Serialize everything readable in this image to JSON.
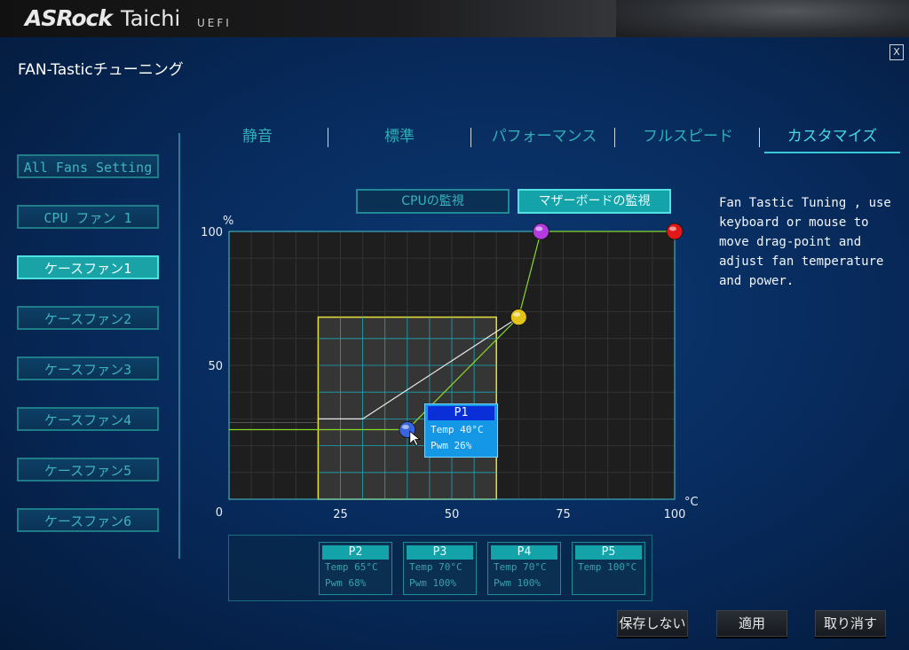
{
  "header": {
    "brand_a": "ASRock",
    "brand_b": "Taichi",
    "brand_c": "UEFI"
  },
  "window": {
    "title": "FAN-Tasticチューニング",
    "close_label": "X"
  },
  "sidebar": {
    "items": [
      {
        "label": "All Fans Setting",
        "active": false
      },
      {
        "label": "CPU ファン 1",
        "active": false
      },
      {
        "label": "ケースファン1",
        "active": true
      },
      {
        "label": "ケースファン2",
        "active": false
      },
      {
        "label": "ケースファン3",
        "active": false
      },
      {
        "label": "ケースファン4",
        "active": false
      },
      {
        "label": "ケースファン5",
        "active": false
      },
      {
        "label": "ケースファン6",
        "active": false
      }
    ]
  },
  "tabs": [
    {
      "label": "静音",
      "active": false
    },
    {
      "label": "標準",
      "active": false
    },
    {
      "label": "パフォーマンス",
      "active": false
    },
    {
      "label": "フルスピード",
      "active": false
    },
    {
      "label": "カスタマイズ",
      "active": true
    }
  ],
  "monitor": {
    "cpu_label": "CPUの監視",
    "mb_label": "マザーボードの監視",
    "selected": "mb"
  },
  "help_text": "Fan Tastic Tuning , use keyboard or mouse to move drag-point and adjust fan temperature and power.",
  "chart_data": {
    "type": "line",
    "ylabel": "%",
    "xlabel": "°C",
    "xlim": [
      0,
      100
    ],
    "ylim": [
      0,
      100
    ],
    "x_ticks": [
      "25",
      "50",
      "75",
      "100"
    ],
    "y_ticks": [
      "0",
      "50",
      "100"
    ],
    "grid": true,
    "series": [
      {
        "points": [
          [
            0,
            26
          ],
          [
            40,
            26
          ],
          [
            65,
            68
          ],
          [
            70,
            100
          ],
          [
            100,
            100
          ]
        ]
      }
    ],
    "reference_line": {
      "points": [
        [
          20,
          30
        ],
        [
          30,
          30
        ],
        [
          65,
          68
        ]
      ]
    },
    "highlight_range": {
      "x": [
        20,
        60
      ],
      "y": [
        0,
        68
      ]
    },
    "point_colors": [
      "#3a63e0",
      "#e3c21a",
      "#b43be0",
      "#e01818"
    ]
  },
  "p1": {
    "title": "P1",
    "temp": "Temp 40°C",
    "pwm": "Pwm  26%"
  },
  "points": [
    {
      "title": "P2",
      "temp": "Temp 65°C",
      "pwm": "Pwm  68%"
    },
    {
      "title": "P3",
      "temp": "Temp 70°C",
      "pwm": "Pwm  100%"
    },
    {
      "title": "P4",
      "temp": "Temp 70°C",
      "pwm": "Pwm  100%"
    },
    {
      "title": "P5",
      "temp": "Temp 100°C",
      "pwm": ""
    }
  ],
  "footer": {
    "no_save": "保存しない",
    "apply": "適用",
    "cancel": "取り消す"
  }
}
